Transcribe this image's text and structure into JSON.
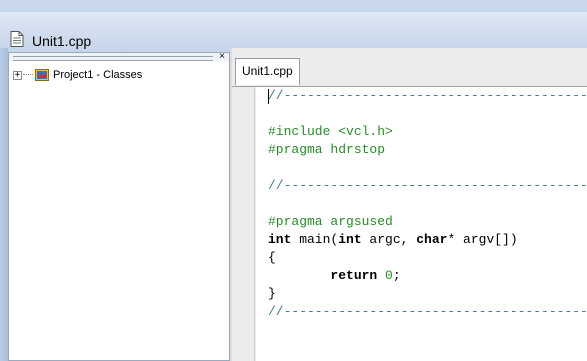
{
  "window": {
    "title": "Unit1.cpp"
  },
  "explorer": {
    "close_glyph": "×",
    "tree": [
      {
        "expander": "+",
        "label": "Project1 - Classes",
        "icon": "project-icon"
      }
    ]
  },
  "editor": {
    "tabs": [
      {
        "label": "Unit1.cpp",
        "active": true
      }
    ],
    "code_lines": [
      {
        "text": "//------------------------------------------",
        "style": "comment"
      },
      {
        "text": "",
        "style": "plain"
      },
      {
        "text": "#include <vcl.h>",
        "style": "pre"
      },
      {
        "text": "#pragma hdrstop",
        "style": "pre"
      },
      {
        "text": "",
        "style": "plain"
      },
      {
        "text": "//------------------------------------------",
        "style": "comment"
      },
      {
        "text": "",
        "style": "plain"
      },
      {
        "text": "#pragma argsused",
        "style": "pre"
      },
      {
        "text": "int main(int argc, char* argv[])",
        "style": "mixed"
      },
      {
        "text": "{",
        "style": "plain"
      },
      {
        "text": "        return 0;",
        "style": "mixed"
      },
      {
        "text": "}",
        "style": "plain"
      },
      {
        "text": "//------------------------------------------",
        "style": "comment"
      }
    ],
    "code_parts": {
      "line8": {
        "kw1": "int",
        "rest1": " main(",
        "kw2": "int",
        "rest2": " argc, ",
        "kw3": "char",
        "rest3": "* argv[])"
      },
      "line10": {
        "indent": "        ",
        "kw": "return",
        "space": " ",
        "num": "0",
        "tail": ";"
      }
    }
  },
  "colors": {
    "preprocessor": "#2b8a2b",
    "comment": "#3d7f8a",
    "number": "#2b8a2b"
  }
}
